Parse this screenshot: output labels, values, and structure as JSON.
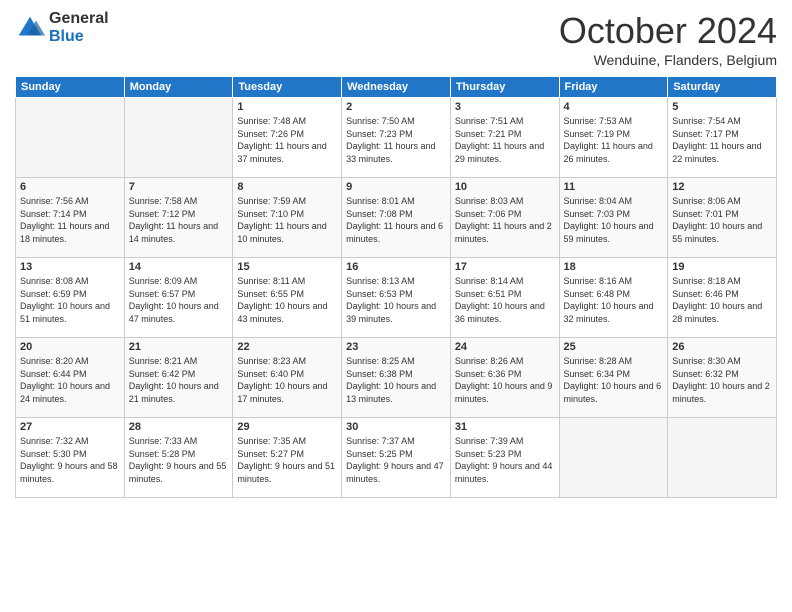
{
  "logo": {
    "general": "General",
    "blue": "Blue"
  },
  "header": {
    "month": "October 2024",
    "location": "Wenduine, Flanders, Belgium"
  },
  "days_of_week": [
    "Sunday",
    "Monday",
    "Tuesday",
    "Wednesday",
    "Thursday",
    "Friday",
    "Saturday"
  ],
  "weeks": [
    [
      {
        "day": "",
        "info": ""
      },
      {
        "day": "",
        "info": ""
      },
      {
        "day": "1",
        "sunrise": "7:48 AM",
        "sunset": "7:26 PM",
        "daylight": "11 hours and 37 minutes."
      },
      {
        "day": "2",
        "sunrise": "7:50 AM",
        "sunset": "7:23 PM",
        "daylight": "11 hours and 33 minutes."
      },
      {
        "day": "3",
        "sunrise": "7:51 AM",
        "sunset": "7:21 PM",
        "daylight": "11 hours and 29 minutes."
      },
      {
        "day": "4",
        "sunrise": "7:53 AM",
        "sunset": "7:19 PM",
        "daylight": "11 hours and 26 minutes."
      },
      {
        "day": "5",
        "sunrise": "7:54 AM",
        "sunset": "7:17 PM",
        "daylight": "11 hours and 22 minutes."
      }
    ],
    [
      {
        "day": "6",
        "sunrise": "7:56 AM",
        "sunset": "7:14 PM",
        "daylight": "11 hours and 18 minutes."
      },
      {
        "day": "7",
        "sunrise": "7:58 AM",
        "sunset": "7:12 PM",
        "daylight": "11 hours and 14 minutes."
      },
      {
        "day": "8",
        "sunrise": "7:59 AM",
        "sunset": "7:10 PM",
        "daylight": "11 hours and 10 minutes."
      },
      {
        "day": "9",
        "sunrise": "8:01 AM",
        "sunset": "7:08 PM",
        "daylight": "11 hours and 6 minutes."
      },
      {
        "day": "10",
        "sunrise": "8:03 AM",
        "sunset": "7:06 PM",
        "daylight": "11 hours and 2 minutes."
      },
      {
        "day": "11",
        "sunrise": "8:04 AM",
        "sunset": "7:03 PM",
        "daylight": "10 hours and 59 minutes."
      },
      {
        "day": "12",
        "sunrise": "8:06 AM",
        "sunset": "7:01 PM",
        "daylight": "10 hours and 55 minutes."
      }
    ],
    [
      {
        "day": "13",
        "sunrise": "8:08 AM",
        "sunset": "6:59 PM",
        "daylight": "10 hours and 51 minutes."
      },
      {
        "day": "14",
        "sunrise": "8:09 AM",
        "sunset": "6:57 PM",
        "daylight": "10 hours and 47 minutes."
      },
      {
        "day": "15",
        "sunrise": "8:11 AM",
        "sunset": "6:55 PM",
        "daylight": "10 hours and 43 minutes."
      },
      {
        "day": "16",
        "sunrise": "8:13 AM",
        "sunset": "6:53 PM",
        "daylight": "10 hours and 39 minutes."
      },
      {
        "day": "17",
        "sunrise": "8:14 AM",
        "sunset": "6:51 PM",
        "daylight": "10 hours and 36 minutes."
      },
      {
        "day": "18",
        "sunrise": "8:16 AM",
        "sunset": "6:48 PM",
        "daylight": "10 hours and 32 minutes."
      },
      {
        "day": "19",
        "sunrise": "8:18 AM",
        "sunset": "6:46 PM",
        "daylight": "10 hours and 28 minutes."
      }
    ],
    [
      {
        "day": "20",
        "sunrise": "8:20 AM",
        "sunset": "6:44 PM",
        "daylight": "10 hours and 24 minutes."
      },
      {
        "day": "21",
        "sunrise": "8:21 AM",
        "sunset": "6:42 PM",
        "daylight": "10 hours and 21 minutes."
      },
      {
        "day": "22",
        "sunrise": "8:23 AM",
        "sunset": "6:40 PM",
        "daylight": "10 hours and 17 minutes."
      },
      {
        "day": "23",
        "sunrise": "8:25 AM",
        "sunset": "6:38 PM",
        "daylight": "10 hours and 13 minutes."
      },
      {
        "day": "24",
        "sunrise": "8:26 AM",
        "sunset": "6:36 PM",
        "daylight": "10 hours and 9 minutes."
      },
      {
        "day": "25",
        "sunrise": "8:28 AM",
        "sunset": "6:34 PM",
        "daylight": "10 hours and 6 minutes."
      },
      {
        "day": "26",
        "sunrise": "8:30 AM",
        "sunset": "6:32 PM",
        "daylight": "10 hours and 2 minutes."
      }
    ],
    [
      {
        "day": "27",
        "sunrise": "7:32 AM",
        "sunset": "5:30 PM",
        "daylight": "9 hours and 58 minutes."
      },
      {
        "day": "28",
        "sunrise": "7:33 AM",
        "sunset": "5:28 PM",
        "daylight": "9 hours and 55 minutes."
      },
      {
        "day": "29",
        "sunrise": "7:35 AM",
        "sunset": "5:27 PM",
        "daylight": "9 hours and 51 minutes."
      },
      {
        "day": "30",
        "sunrise": "7:37 AM",
        "sunset": "5:25 PM",
        "daylight": "9 hours and 47 minutes."
      },
      {
        "day": "31",
        "sunrise": "7:39 AM",
        "sunset": "5:23 PM",
        "daylight": "9 hours and 44 minutes."
      },
      {
        "day": "",
        "info": ""
      },
      {
        "day": "",
        "info": ""
      }
    ]
  ]
}
